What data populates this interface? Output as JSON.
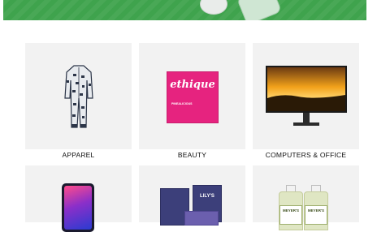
{
  "colors": {
    "banner": "#3fa34d",
    "tile_bg": "#f2f2f2",
    "text": "#111111"
  },
  "banner": {
    "icon": "promo-banner-image"
  },
  "categories": [
    {
      "label": "APPAREL",
      "icon": "pajama-image"
    },
    {
      "label": "BEAUTY",
      "icon": "shampoo-bar-image",
      "brand_text": "ethique",
      "product_text": "PINEALICIOUS"
    },
    {
      "label": "COMPUTERS & OFFICE",
      "icon": "monitor-image"
    },
    {
      "label": "",
      "icon": "smartphone-image"
    },
    {
      "label": "",
      "icon": "chocolate-image",
      "brand_text": "LILY'S"
    },
    {
      "label": "",
      "icon": "cleaner-bottles-image",
      "brand_text": "MEYER'S"
    }
  ]
}
